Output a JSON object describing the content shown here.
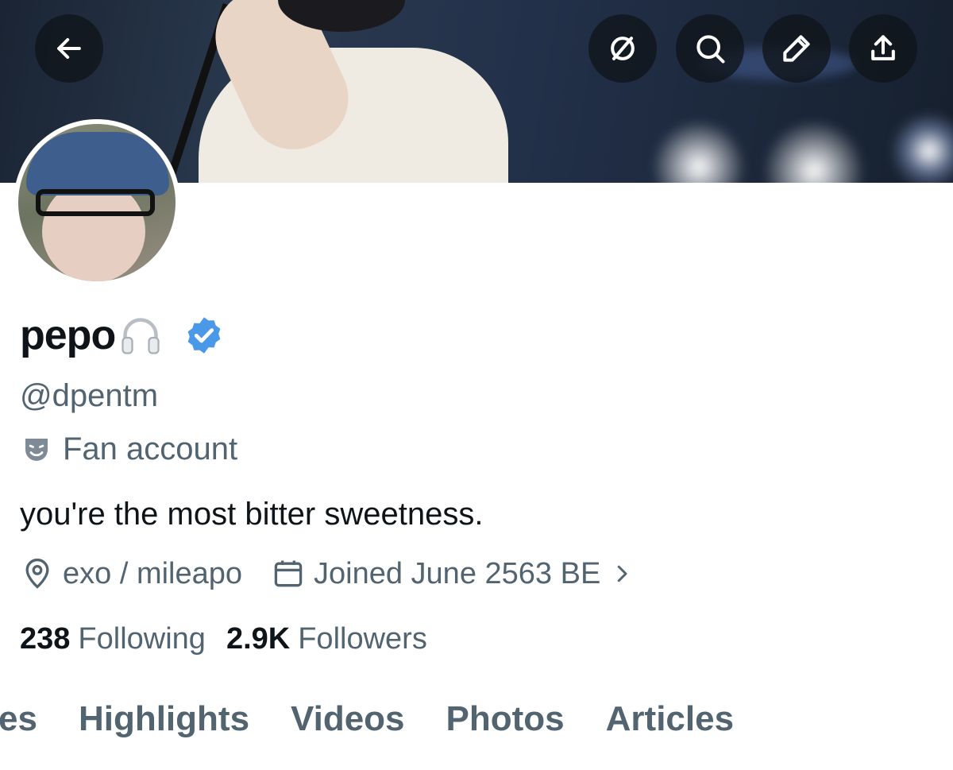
{
  "header": {
    "back_icon": "arrow-left-icon",
    "actions": [
      "unfollow-circle-slash-icon",
      "search-icon",
      "edit-pencil-icon",
      "share-upload-icon"
    ]
  },
  "profile": {
    "display_name": "pepo",
    "name_emoji_icon": "headphones-icon",
    "verified": true,
    "verified_color": "#4a99e9",
    "handle": "@dpentm",
    "category": "Fan account",
    "category_icon": "theater-mask-icon",
    "bio": "you're the most bitter sweetness.",
    "location": "exo / mileapo",
    "location_icon": "map-pin-icon",
    "joined": "Joined June 2563 BE",
    "joined_icon": "calendar-icon",
    "following_count": "238",
    "following_label": "Following",
    "followers_count": "2.9K",
    "followers_label": "Followers"
  },
  "tabs": [
    "es",
    "Highlights",
    "Videos",
    "Photos",
    "Articles"
  ],
  "colors": {
    "text_primary": "#0f1419",
    "text_secondary": "#536471",
    "accent": "#1d9bf0"
  }
}
